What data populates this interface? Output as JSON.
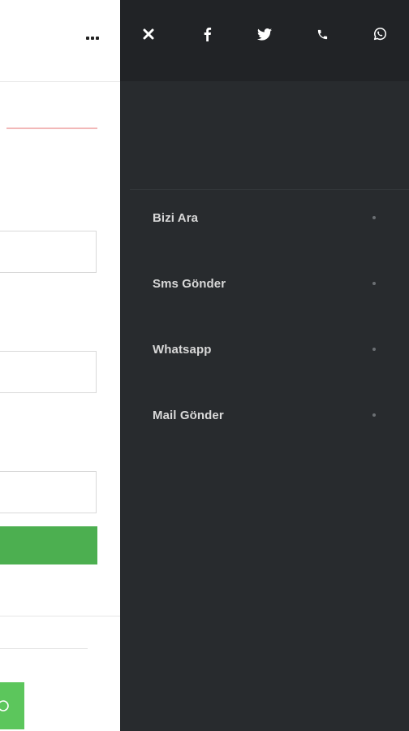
{
  "social_bar": {
    "icons": [
      "close-icon",
      "facebook-icon",
      "twitter-icon",
      "phone-icon",
      "whatsapp-icon"
    ]
  },
  "menu": {
    "items": [
      {
        "label": "Bizi Ara",
        "icon": "dot-icon"
      },
      {
        "label": "Sms Gönder",
        "icon": "dot-icon"
      },
      {
        "label": "Whatsapp",
        "icon": "dot-icon"
      },
      {
        "label": "Mail Gönder",
        "icon": "dot-icon"
      }
    ]
  },
  "colors": {
    "panel_bg": "#282b2e",
    "panel_top_bg": "#212326",
    "submit_green": "#4caf50",
    "whatsapp_green": "#5cc65c",
    "accent_line": "#f2b8b8"
  }
}
